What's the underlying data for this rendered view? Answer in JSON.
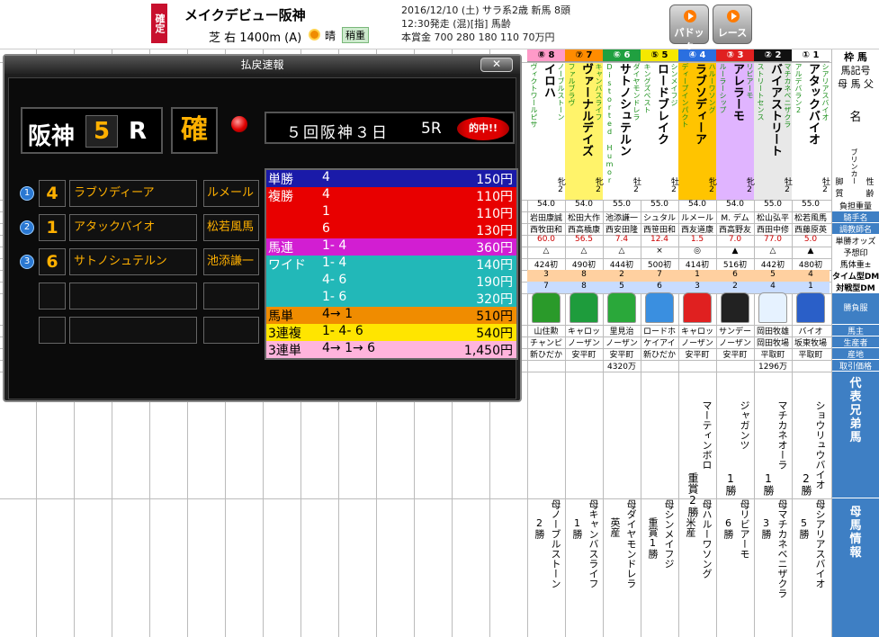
{
  "header": {
    "confirmed_badge": "確定",
    "race_title": "メイクデビュー阪神",
    "course": "芝 右 1400m (A)",
    "weather": "晴",
    "going": "稍重",
    "meta_line1": "2016/12/10 (土)  サラ系2歳  新馬  8頭",
    "meta_line2": "12:30発走  (混)[指]  馬齢",
    "meta_line3": "本賞金  700 280 180 110 70万円",
    "paddock_label": "パドック",
    "race_label": "レース"
  },
  "labels": {
    "waku": "枠",
    "uma": "馬",
    "umakigo": "馬記号",
    "haha": "母",
    "uma2": "馬",
    "chichi": "父",
    "na": "名",
    "blinker": "ブリンカー",
    "kyakushitsu": "脚質",
    "seirei": "性齢",
    "futan": "負担重量",
    "kishu": "騎手名",
    "choukyou": "調教師名",
    "odds": "単勝オッズ",
    "yosou": "予想印",
    "bataiju": "馬体重±",
    "timetype": "タイム型DM",
    "taisen": "対戦型DM",
    "shoubufuku": "勝負服",
    "banushi": "馬主",
    "seisansha": "生産者",
    "sanchi": "産地",
    "torihiki": "取引価格",
    "daihyo": "代表兄弟馬",
    "bouma": "母馬情報"
  },
  "horses": [
    {
      "waku": "①",
      "num": "1",
      "name": "アタックバイオ",
      "sire": "シアリアスバイオ",
      "dam": "アルデバラン2",
      "sex": "牡2",
      "weight": "55.0",
      "jockey": "松若風馬",
      "trainer": "西藤原英",
      "odds": "5.0",
      "mark": "▲",
      "bw": "480初",
      "tdm": "4",
      "fdm": "1",
      "owner": "バイオ",
      "breeder": "坂東牧場",
      "origin": "平取町",
      "price": "",
      "bro": "ショウリュウバイオ",
      "bro_wins": "2勝",
      "dam_info": "母シアリアスバイオ",
      "dam_wins": "5勝",
      "silk": "#2a5fc8"
    },
    {
      "waku": "②",
      "num": "2",
      "name": "バイアストリート",
      "sire": "マチカネベニザクラ",
      "dam": "ストリートセンス",
      "sex": "牡2",
      "weight": "55.0",
      "jockey": "松山弘平",
      "trainer": "西田中修",
      "odds": "77.0",
      "mark": "△",
      "bw": "442初",
      "tdm": "5",
      "fdm": "4",
      "owner": "岡田牧雄",
      "breeder": "岡田牧場",
      "origin": "平取町",
      "price": "1296万",
      "bro": "マチカネオーラ",
      "bro_wins": "1勝",
      "dam_info": "母マチカネベニザクラ",
      "dam_wins": "3勝",
      "silk": "#e6f2ff"
    },
    {
      "waku": "③",
      "num": "3",
      "name": "アレラーモ",
      "sire": "リビアーモ",
      "dam": "ルーラーシップ",
      "sex": "牝2",
      "weight": "54.0",
      "jockey": "M. デム",
      "trainer": "西高野友",
      "odds": "7.0",
      "mark": "▲",
      "bw": "516初",
      "tdm": "6",
      "fdm": "2",
      "owner": "サンデー",
      "breeder": "ノーザン",
      "origin": "安平町",
      "price": "",
      "bro": "ジャガンツ",
      "bro_wins": "1勝",
      "dam_info": "母リビアーモ",
      "dam_wins": "6勝",
      "silk": "#222222"
    },
    {
      "waku": "④",
      "num": "4",
      "name": "ラブソディーア",
      "sire": "ハルーワソング",
      "dam": "ディープインパクト",
      "sex": "牝2",
      "weight": "54.0",
      "jockey": "ルメール",
      "trainer": "西友道康",
      "odds": "1.5",
      "mark": "◎",
      "bw": "414初",
      "tdm": "1",
      "fdm": "3",
      "owner": "キャロッ",
      "breeder": "ノーザン",
      "origin": "安平町",
      "price": "",
      "bro": "マーティンボロ",
      "bro_wins": "重賞2勝",
      "dam_info": "母ハルーワソング",
      "dam_wins": "米産",
      "silk": "#e02020"
    },
    {
      "waku": "⑤",
      "num": "5",
      "name": "ロードブレイク",
      "sire": "シンメイフジ",
      "dam": "キングズベスト",
      "sex": "牡2",
      "weight": "55.0",
      "jockey": "シュタル",
      "trainer": "西笹田和",
      "odds": "12.4",
      "mark": "×",
      "bw": "500初",
      "tdm": "7",
      "fdm": "6",
      "owner": "ロードホ",
      "breeder": "ケイアイ",
      "origin": "新ひだか",
      "price": "",
      "bro": "",
      "bro_wins": "",
      "dam_info": "母シンメイフジ",
      "dam_wins": "重賞1勝",
      "silk": "#3a8fe0"
    },
    {
      "waku": "⑥",
      "num": "6",
      "name": "サトノシュテルン",
      "sire": "ダイヤモンドレラ",
      "dam": "Distorted Humor",
      "sex": "牡2",
      "weight": "55.0",
      "jockey": "池添謙一",
      "trainer": "西安田隆",
      "odds": "7.4",
      "mark": "△",
      "bw": "444初",
      "tdm": "2",
      "fdm": "5",
      "owner": "里見治",
      "breeder": "ノーザン",
      "origin": "安平町",
      "price": "4320万",
      "bro": "",
      "bro_wins": "",
      "dam_info": "母ダイヤモンドレラ",
      "dam_wins": "英産",
      "silk": "#2aa83a"
    },
    {
      "waku": "⑦",
      "num": "7",
      "name": "ヴァーナルデイズ",
      "sire": "キャンバスライフ",
      "dam": "ファルブラヴ",
      "sex": "牝2",
      "weight": "54.0",
      "jockey": "松田大作",
      "trainer": "西高橋康",
      "odds": "56.5",
      "mark": "△",
      "bw": "490初",
      "tdm": "8",
      "fdm": "8",
      "owner": "キャロッ",
      "breeder": "ノーザン",
      "origin": "安平町",
      "price": "",
      "bro": "",
      "bro_wins": "",
      "dam_info": "母キャンバスライフ",
      "dam_wins": "1勝",
      "silk": "#1e9c3c"
    },
    {
      "waku": "⑧",
      "num": "8",
      "name": "イロハ",
      "sire": "ノーブルストーン",
      "dam": "ヴィクトワールピサ",
      "sex": "牝2",
      "weight": "54.0",
      "jockey": "岩田康誠",
      "trainer": "西牧田和",
      "odds": "60.0",
      "mark": "△",
      "bw": "424初",
      "tdm": "3",
      "fdm": "7",
      "owner": "山住勲",
      "breeder": "チャンピ",
      "origin": "新ひだか",
      "price": "",
      "bro": "",
      "bro_wins": "",
      "dam_info": "母ノーブルストーン",
      "dam_wins": "2勝",
      "silk": "#2a9a2a"
    }
  ],
  "panel": {
    "title": "払戻速報",
    "close_label": "✕",
    "venue": "阪神",
    "race_num": "5",
    "race_r": "R",
    "kakutei": "確",
    "meeting": "５回阪神３日",
    "meeting_race": "5R",
    "hit_badge": "的中!!",
    "placings": [
      {
        "pos": "1",
        "num": "4",
        "horse": "ラブソディーア",
        "jockey": "ルメール"
      },
      {
        "pos": "2",
        "num": "1",
        "horse": "アタックバイオ",
        "jockey": "松若風馬"
      },
      {
        "pos": "3",
        "num": "6",
        "horse": "サトノシュテルン",
        "jockey": "池添謙一"
      }
    ],
    "payouts": [
      {
        "type": "単勝",
        "combo": "4",
        "amount": "150円",
        "bg": "#1a1aa8"
      },
      {
        "type": "複勝",
        "combo": "4",
        "amount": "110円",
        "bg": "#e80000"
      },
      {
        "type": "",
        "combo": "1",
        "amount": "110円",
        "bg": "#e80000"
      },
      {
        "type": "",
        "combo": "6",
        "amount": "130円",
        "bg": "#e80000"
      },
      {
        "type": "馬連",
        "combo": "1- 4",
        "amount": "360円",
        "bg": "#d21ed2"
      },
      {
        "type": "ワイド",
        "combo": "1- 4",
        "amount": "140円",
        "bg": "#22b8b8"
      },
      {
        "type": "",
        "combo": "4- 6",
        "amount": "190円",
        "bg": "#22b8b8"
      },
      {
        "type": "",
        "combo": "1- 6",
        "amount": "320円",
        "bg": "#22b8b8"
      },
      {
        "type": "馬単",
        "combo": "4→ 1",
        "amount": "510円",
        "bg": "#f08c00"
      },
      {
        "type": "3連複",
        "combo": "1- 4- 6",
        "amount": "540円",
        "bg": "#ffe500"
      },
      {
        "type": "3連単",
        "combo": "4→ 1→ 6",
        "amount": "1,450円",
        "bg": "#ffb4dc"
      }
    ]
  }
}
